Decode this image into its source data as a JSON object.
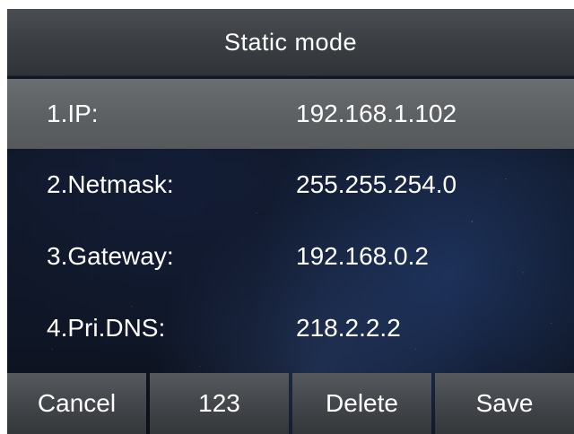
{
  "header": {
    "title": "Static mode"
  },
  "fields": [
    {
      "label": "1.IP:",
      "value": "192.168.1.102",
      "selected": true
    },
    {
      "label": "2.Netmask:",
      "value": "255.255.254.0",
      "selected": false
    },
    {
      "label": "3.Gateway:",
      "value": "192.168.0.2",
      "selected": false
    },
    {
      "label": "4.Pri.DNS:",
      "value": "218.2.2.2",
      "selected": false
    }
  ],
  "softkeys": {
    "cancel": "Cancel",
    "input_mode": "123",
    "delete": "Delete",
    "save": "Save"
  },
  "colors": {
    "selected_row": "#5e6163",
    "title_bar": "#3a3d42",
    "softkey": "#45484c",
    "text": "#ffffff"
  }
}
